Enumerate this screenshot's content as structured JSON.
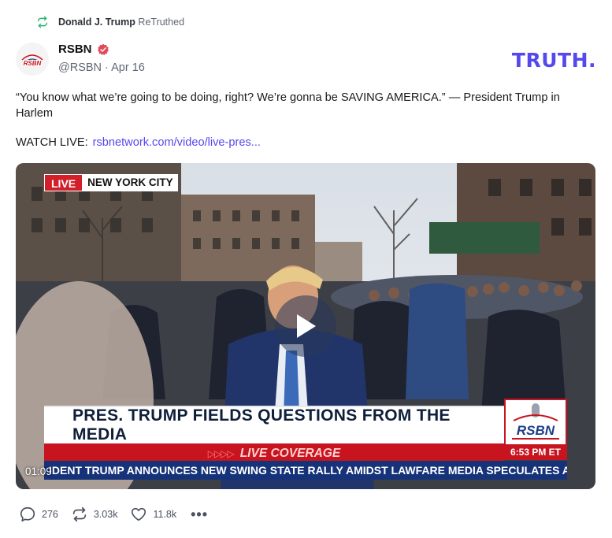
{
  "retruth": {
    "user": "Donald J. Trump",
    "label": "ReTruthed",
    "icon": "retruth-icon"
  },
  "author": {
    "name": "RSBN",
    "handle": "@RSBN",
    "date": "Apr 16",
    "separator": "·",
    "verified_icon": "verified-badge-icon",
    "avatar_text": "RSBN"
  },
  "brand": {
    "logo_text": "TRUTH",
    "logo_dot": ".",
    "color": "#5448ee"
  },
  "post": {
    "text": "“You know what we’re going to be doing, right? We’re gonna be SAVING AMERICA.” — President Trump in Harlem",
    "watch_label": "WATCH LIVE:",
    "link_text": "rsbnetwork.com/video/live-pres..."
  },
  "video": {
    "live_label": "LIVE",
    "location": "NEW YORK CITY",
    "headline": "PRES. TRUMP FIELDS QUESTIONS FROM THE MEDIA",
    "coverage_arrows": "▷▷▷▷",
    "coverage": "LIVE COVERAGE",
    "logo_text": "RSBN",
    "clock": "6:53 PM ET",
    "ticker": "IDENT TRUMP ANNOUNCES NEW SWING STATE RALLY AMIDST LAWFARE    MEDIA SPECULATES AR",
    "timestamp": "01:09",
    "play_icon": "play-icon"
  },
  "actions": {
    "replies": "276",
    "retruths": "3.03k",
    "likes": "11.8k",
    "more": "•••"
  }
}
